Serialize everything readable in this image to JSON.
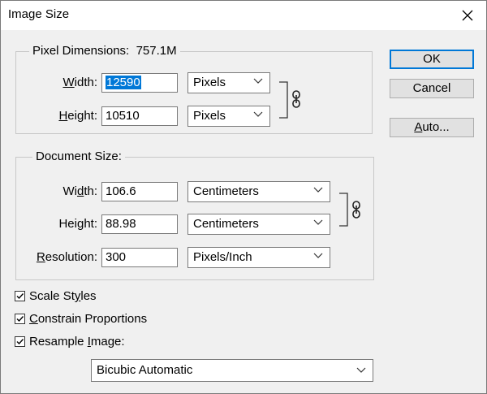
{
  "window": {
    "title": "Image Size"
  },
  "pixel_dimensions": {
    "legend": "Pixel Dimensions:",
    "size": "757.1M",
    "width": {
      "label_pre": "",
      "label_u": "W",
      "label_post": "idth:",
      "value": "12590",
      "unit": "Pixels"
    },
    "height": {
      "label_pre": "",
      "label_u": "H",
      "label_post": "eight:",
      "value": "10510",
      "unit": "Pixels"
    }
  },
  "document_size": {
    "legend": "Document Size:",
    "width": {
      "label_pre": "Wi",
      "label_u": "d",
      "label_post": "th:",
      "value": "106.6",
      "unit": "Centimeters"
    },
    "height": {
      "label_pre": "Hei",
      "label_u": "g",
      "label_post": "ht:",
      "value": "88.98",
      "unit": "Centimeters"
    },
    "resolution": {
      "label_pre": "",
      "label_u": "R",
      "label_post": "esolution:",
      "value": "300",
      "unit": "Pixels/Inch"
    }
  },
  "options": {
    "scale_styles": {
      "pre": "Scale St",
      "u": "y",
      "post": "les",
      "checked": true
    },
    "constrain": {
      "pre": "",
      "u": "C",
      "post": "onstrain Proportions",
      "checked": true
    },
    "resample": {
      "pre": "Resample ",
      "u": "I",
      "post": "mage:",
      "checked": true
    },
    "method": "Bicubic Automatic"
  },
  "buttons": {
    "ok": "OK",
    "cancel": "Cancel",
    "auto_u": "A",
    "auto_post": "uto..."
  }
}
